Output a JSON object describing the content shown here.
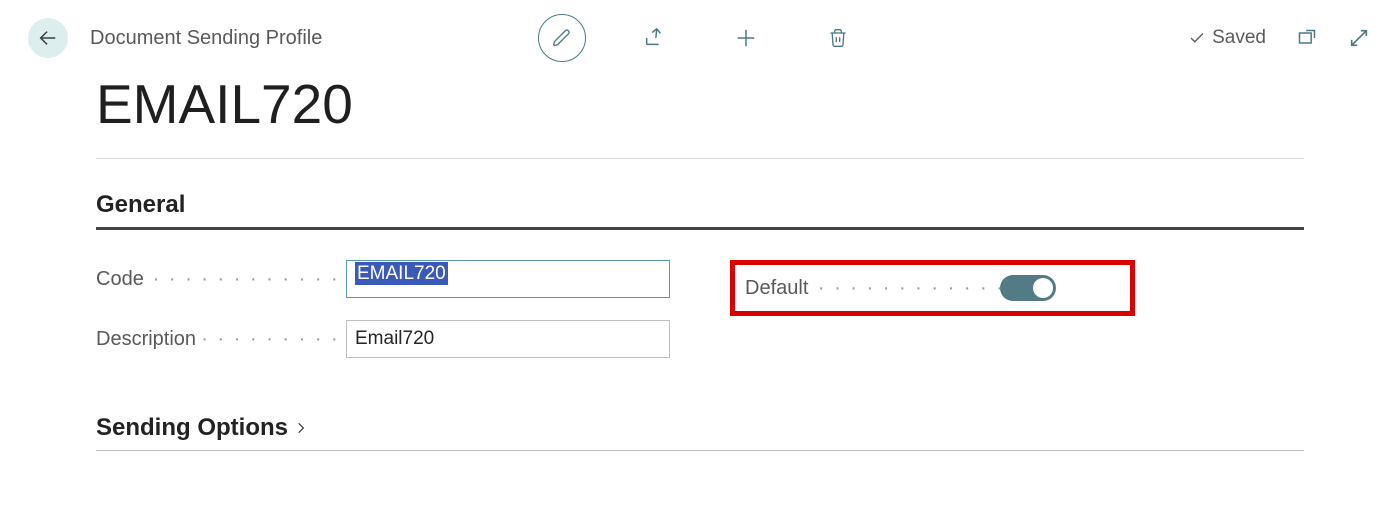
{
  "header": {
    "page_label": "Document Sending Profile",
    "title": "EMAIL720",
    "saved_label": "Saved"
  },
  "sections": {
    "general": {
      "heading": "General",
      "fields": {
        "code_label": "Code",
        "code_value": "EMAIL720",
        "description_label": "Description",
        "description_value": "Email720",
        "default_label": "Default",
        "default_on": true
      }
    },
    "sending_options": {
      "heading": "Sending Options"
    }
  },
  "icons": {
    "back": "back-arrow-icon",
    "edit": "pencil-icon",
    "share": "share-icon",
    "new": "plus-icon",
    "delete": "trash-icon",
    "saved_check": "check-icon",
    "popout": "popout-icon",
    "expand": "expand-arrows-icon",
    "chevron": "chevron-right-icon"
  }
}
